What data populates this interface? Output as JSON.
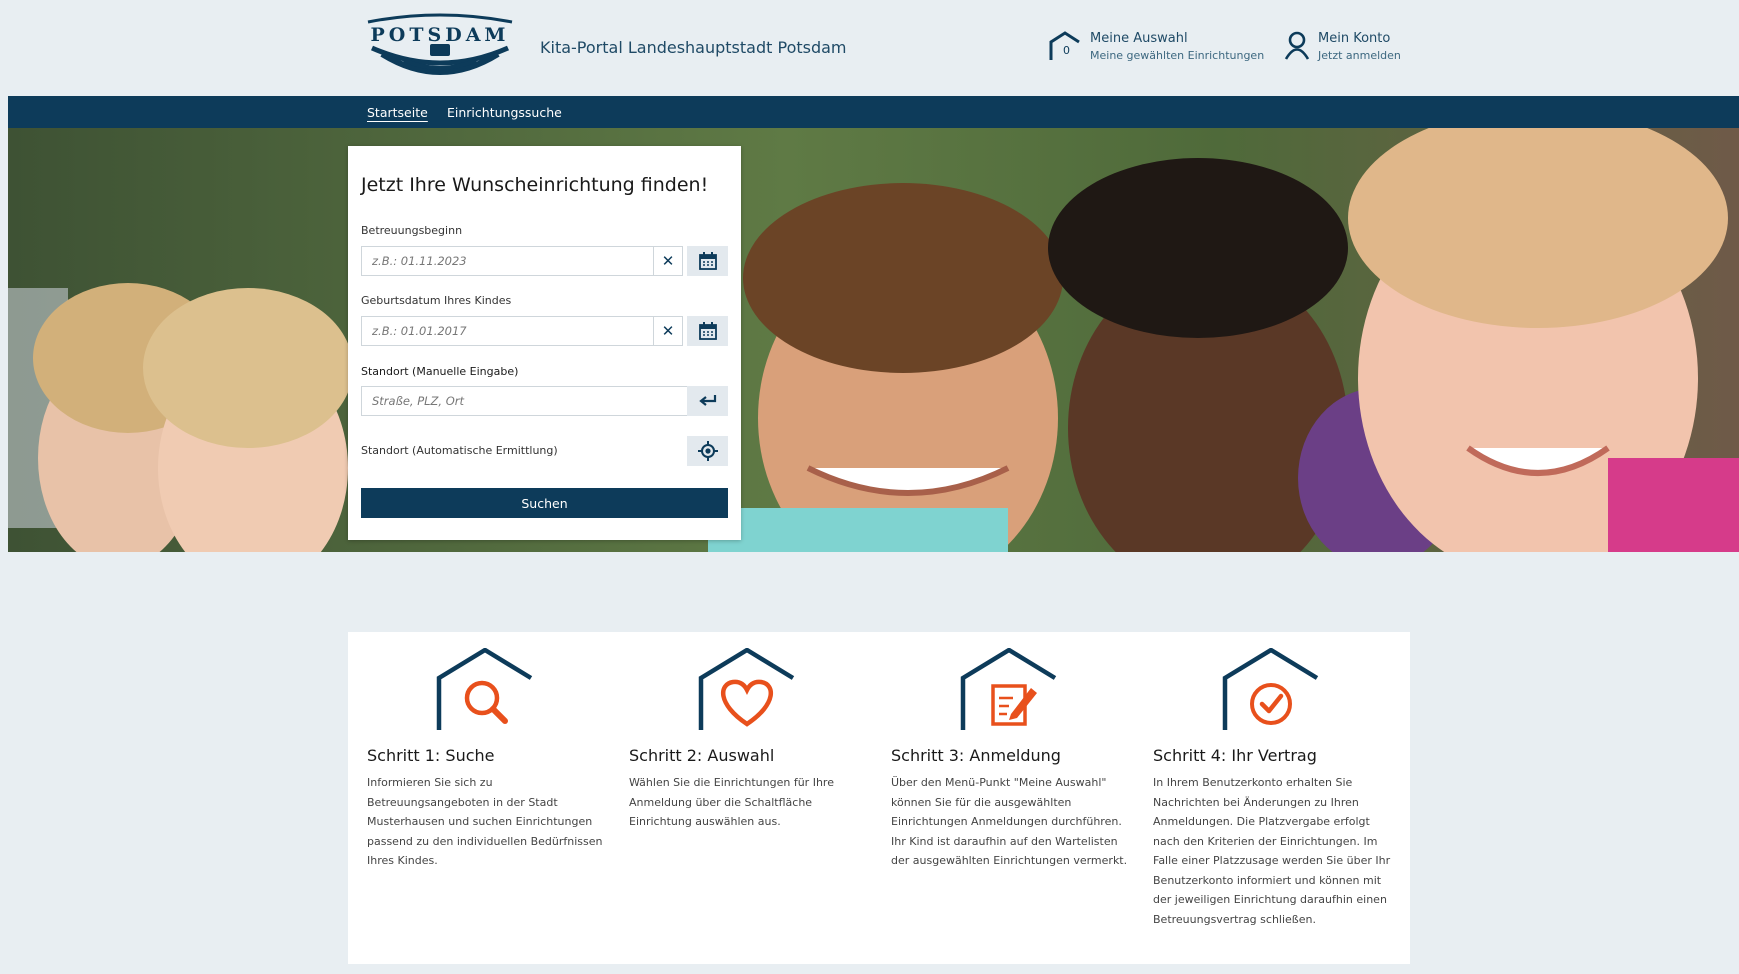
{
  "header": {
    "logo_text": "POTSDAM",
    "site_title": "Kita-Portal Landeshauptstadt Potsdam",
    "selection": {
      "count": "0",
      "title": "Meine Auswahl",
      "subtitle": "Meine gewählten Einrichtungen",
      "icon": "house-outline-icon"
    },
    "account": {
      "title": "Mein Konto",
      "subtitle": "Jetzt anmelden",
      "icon": "user-icon"
    }
  },
  "nav": {
    "items": [
      {
        "label": "Startseite",
        "active": true
      },
      {
        "label": "Einrichtungssuche",
        "active": false
      }
    ]
  },
  "search": {
    "title": "Jetzt Ihre Wunscheinrichtung finden!",
    "start_label": "Betreuungsbeginn",
    "start_placeholder": "z.B.: 01.11.2023",
    "birth_label": "Geburtsdatum Ihres Kindes",
    "birth_placeholder": "z.B.: 01.01.2017",
    "location_label": "Standort (Manuelle Eingabe)",
    "location_placeholder": "Straße, PLZ, Ort",
    "auto_location_label": "Standort (Automatische Ermittlung)",
    "submit_label": "Suchen",
    "clear_glyph": "✕"
  },
  "steps": [
    {
      "title": "Schritt 1: Suche",
      "icon": "magnifier-icon",
      "text": "Informieren Sie sich zu Betreuungsangeboten in der Stadt Musterhausen und suchen Einrichtungen passend zu den individuellen Bedürfnissen Ihres Kindes."
    },
    {
      "title": "Schritt 2: Auswahl",
      "icon": "heart-icon",
      "text": "Wählen Sie die Einrichtungen für Ihre Anmeldung über die Schaltfläche Einrichtung auswählen aus."
    },
    {
      "title": "Schritt 3: Anmeldung",
      "icon": "document-edit-icon",
      "text": "Über den Menü-Punkt \"Meine Auswahl\" können Sie für die ausgewählten Einrichtungen Anmeldungen durchführen. Ihr Kind ist daraufhin auf den Wartelisten der ausgewählten Einrichtungen vermerkt."
    },
    {
      "title": "Schritt 4: Ihr Vertrag",
      "icon": "check-circle-icon",
      "text": "In Ihrem Benutzerkonto erhalten Sie Nachrichten bei Änderungen zu Ihren Anmeldungen. Die Platzvergabe erfolgt nach den Kriterien der Einrichtungen. Im Falle einer Platzzusage werden Sie über Ihr Benutzerkonto informiert und können mit der jeweiligen Einrichtung daraufhin einen Betreuungsvertrag schließen."
    }
  ],
  "colors": {
    "primary": "#0d3b5a",
    "accent": "#e8501c",
    "background": "#e8eef2"
  }
}
